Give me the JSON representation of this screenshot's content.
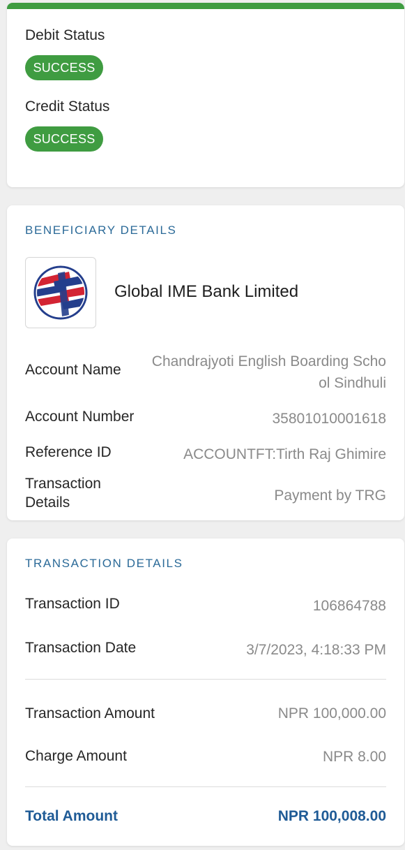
{
  "colors": {
    "success_green": "#3f9c41",
    "section_blue": "#2b6a98",
    "total_blue": "#1f5b96",
    "label_text": "#262626",
    "value_text": "#8a8a8a"
  },
  "status": {
    "debit_label": "Debit Status",
    "debit_value": "SUCCESS",
    "credit_label": "Credit Status",
    "credit_value": "SUCCESS"
  },
  "beneficiary": {
    "title": "BENEFICIARY DETAILS",
    "bank_logo_icon": "global-ime-bank-logo",
    "bank_name": "Global IME Bank Limited",
    "account_name_label": "Account Name",
    "account_name_value": "Chandrajyoti English Boarding School Sindhuli",
    "account_number_label": "Account Number",
    "account_number_value": "35801010001618",
    "reference_id_label": "Reference ID",
    "reference_id_value": "ACCOUNTFT:Tirth Raj Ghimire",
    "transaction_details_label": "Transaction Details",
    "transaction_details_value": "Payment by TRG"
  },
  "transaction": {
    "title": "TRANSACTION DETAILS",
    "id_label": "Transaction ID",
    "id_value": "106864788",
    "date_label": "Transaction Date",
    "date_value": "3/7/2023, 4:18:33 PM",
    "amount_label": "Transaction Amount",
    "amount_value": "NPR 100,000.00",
    "charge_label": "Charge Amount",
    "charge_value": "NPR 8.00",
    "total_label": "Total Amount",
    "total_value": "NPR 100,008.00"
  }
}
